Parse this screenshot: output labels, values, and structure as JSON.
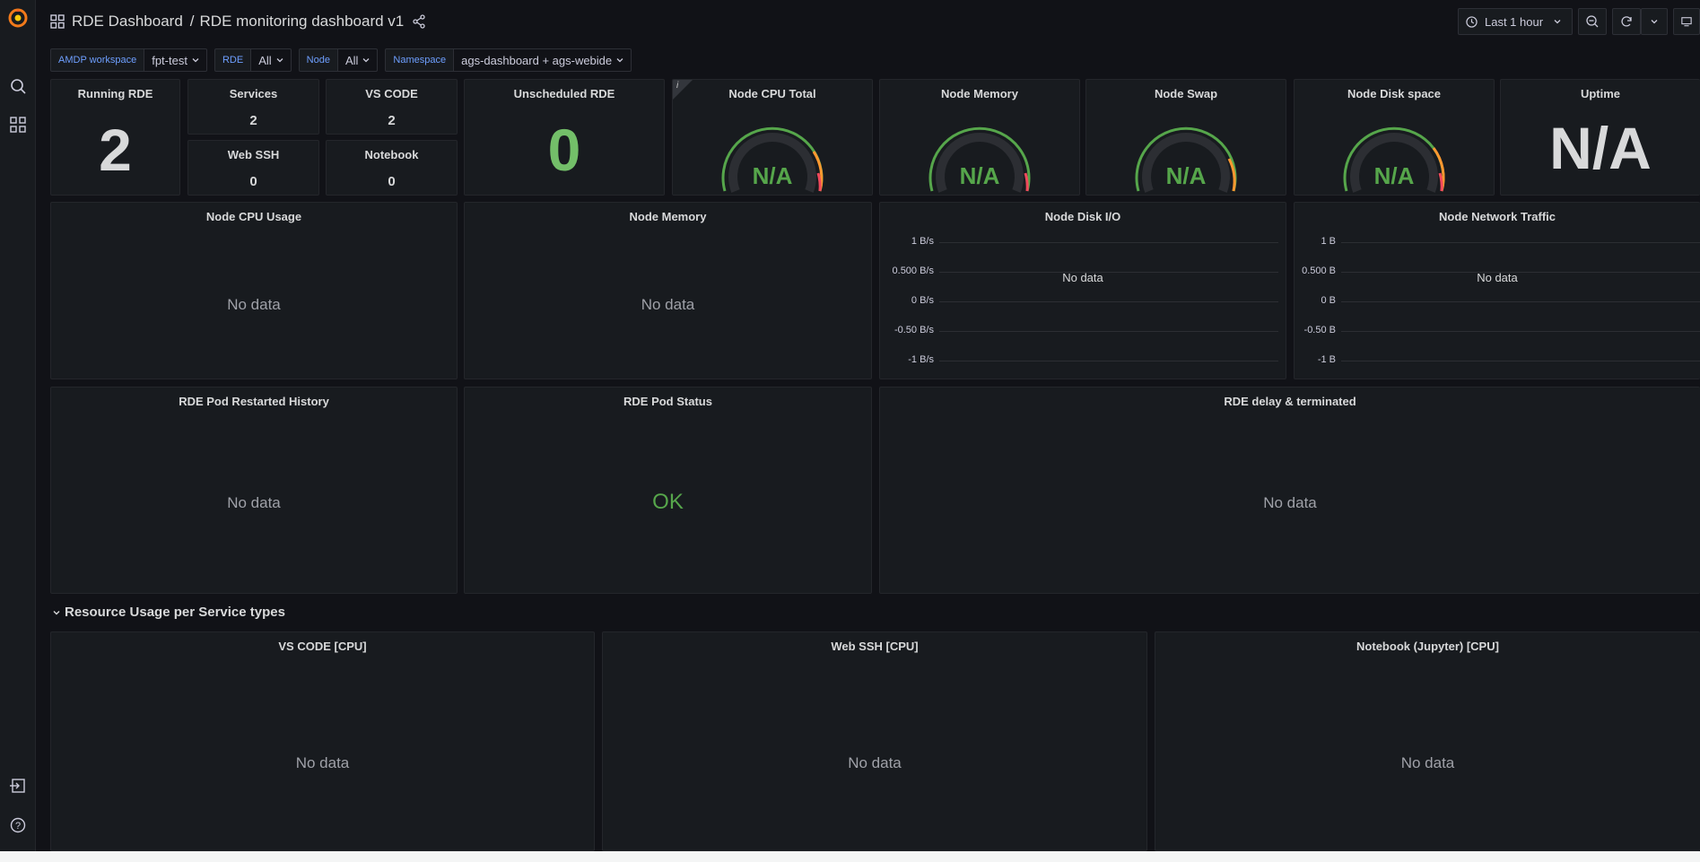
{
  "header": {
    "folder": "RDE Dashboard",
    "separator": "/",
    "dashboard": "RDE monitoring dashboard v1",
    "time_range": "Last 1 hour"
  },
  "variables": [
    {
      "label": "AMDP workspace",
      "value": "fpt-test"
    },
    {
      "label": "RDE",
      "value": "All"
    },
    {
      "label": "Node",
      "value": "All"
    },
    {
      "label": "Namespace",
      "value": "ags-dashboard + ags-webide"
    }
  ],
  "panels": {
    "running_rde": {
      "title": "Running RDE",
      "value": "2"
    },
    "services": {
      "title": "Services",
      "value": "2"
    },
    "vscode": {
      "title": "VS CODE",
      "value": "2"
    },
    "webssh": {
      "title": "Web SSH",
      "value": "0"
    },
    "notebook": {
      "title": "Notebook",
      "value": "0"
    },
    "unscheduled": {
      "title": "Unscheduled RDE",
      "value": "0"
    },
    "cpu_total": {
      "title": "Node CPU Total",
      "value": "N/A",
      "info": "i"
    },
    "node_memory_g": {
      "title": "Node Memory",
      "value": "N/A"
    },
    "node_swap": {
      "title": "Node Swap",
      "value": "N/A"
    },
    "node_disk": {
      "title": "Node Disk space",
      "value": "N/A"
    },
    "uptime": {
      "title": "Uptime",
      "value": "N/A"
    },
    "cpu_usage": {
      "title": "Node CPU Usage",
      "nodata": "No data"
    },
    "node_memory_ts": {
      "title": "Node Memory",
      "nodata": "No data"
    },
    "disk_io": {
      "title": "Node Disk I/O",
      "nodata": "No data",
      "y_ticks": [
        "1 B/s",
        "0.500 B/s",
        "0 B/s",
        "-0.50 B/s",
        "-1 B/s"
      ]
    },
    "net_traffic": {
      "title": "Node Network Traffic",
      "nodata": "No data",
      "y_ticks": [
        "1 B",
        "0.500 B",
        "0 B",
        "-0.50 B",
        "-1 B"
      ]
    },
    "restart_history": {
      "title": "RDE Pod Restarted History",
      "nodata": "No data"
    },
    "pod_status": {
      "title": "RDE Pod Status",
      "value": "OK"
    },
    "delay_terminated": {
      "title": "RDE delay & terminated",
      "nodata": "No data"
    },
    "vscode_cpu": {
      "title": "VS CODE [CPU]",
      "nodata": "No data"
    },
    "webssh_cpu": {
      "title": "Web SSH [CPU]",
      "nodata": "No data"
    },
    "notebook_cpu": {
      "title": "Notebook (Jupyter) [CPU]",
      "nodata": "No data"
    }
  },
  "row": {
    "title": "Resource Usage per Service types"
  },
  "colors": {
    "green": "#73bf69",
    "dark_green": "#56a64b",
    "text_value": "#d8d9da",
    "accent_blue": "#6e9fff"
  },
  "icons": [
    "grafana-logo",
    "search-icon",
    "dashboards-icon",
    "signin-icon",
    "help-icon",
    "grid-icon",
    "share-icon",
    "clock-icon",
    "zoom-out-icon",
    "refresh-icon",
    "tv-icon"
  ]
}
